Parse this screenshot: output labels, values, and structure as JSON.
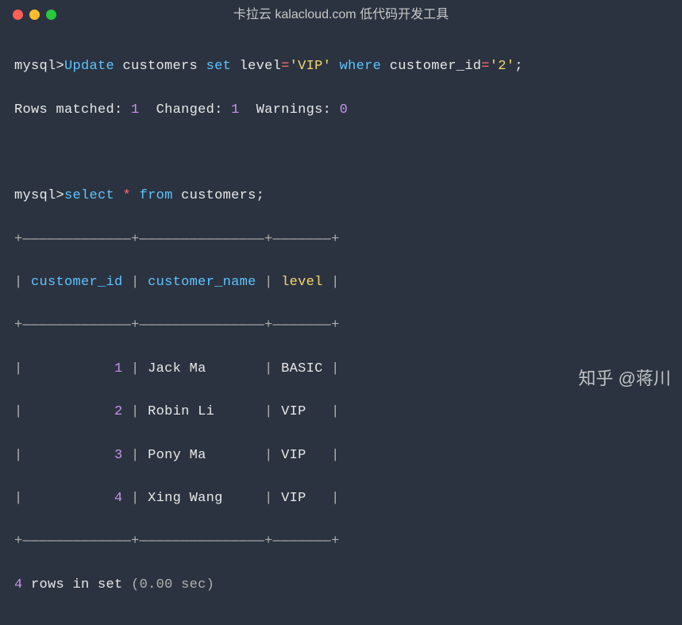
{
  "window": {
    "title": "卡拉云 kalacloud.com 低代码开发工具"
  },
  "line1": {
    "prompt": "mysql>",
    "update": "Update",
    "table": "customers",
    "set": "set",
    "col": "level",
    "eq": "=",
    "val1": "'VIP'",
    "where": "where",
    "col2": "customer_id",
    "val2": "'2'",
    "semi": ";"
  },
  "line2": {
    "matched_label": "Rows matched:",
    "matched_val": "1",
    "changed_label": "Changed:",
    "changed_val": "1",
    "warnings_label": "Warnings:",
    "warnings_val": "0"
  },
  "line3": {
    "prompt": "mysql>",
    "select": "select",
    "star": "*",
    "from": "from",
    "table": "customers",
    "semi": ";"
  },
  "table": {
    "border_top": "+—————————————+———————————————+———————+",
    "border_mid": "+—————————————+———————————————+———————+",
    "border_bot": "+—————————————+———————————————+———————+",
    "h1": "customer_id",
    "h2": "customer_name",
    "h3": "level",
    "rows": [
      {
        "id": "1",
        "name": "Jack Ma",
        "level": "BASIC"
      },
      {
        "id": "2",
        "name": "Robin Li",
        "level": "VIP"
      },
      {
        "id": "3",
        "name": "Pony Ma",
        "level": "VIP"
      },
      {
        "id": "4",
        "name": "Xing Wang",
        "level": "VIP"
      }
    ]
  },
  "footer": {
    "count": "4",
    "rows_in_set": "rows in set",
    "time": "(0.00 sec)"
  },
  "watermark": "知乎 @蒋川"
}
